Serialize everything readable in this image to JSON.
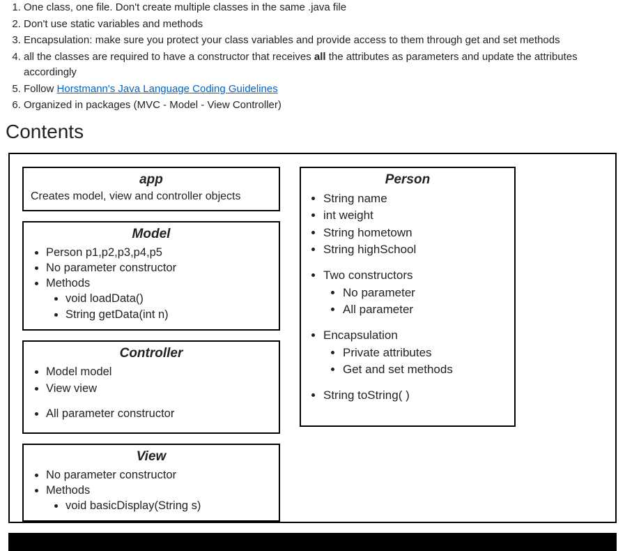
{
  "rules": {
    "r1": "One class, one file. Don't create multiple classes in the same .java file",
    "r2": "Don't use static variables and methods",
    "r3": "Encapsulation: make sure you protect your class variables and provide access to them through get and set methods",
    "r4a": "all the classes are required to have a constructor that receives ",
    "r4b": "all",
    "r4c": " the attributes as parameters and update the attributes accordingly",
    "r5a": "Follow ",
    "r5link": "Horstmann's Java Language Coding Guidelines",
    "r6": "Organized in packages (MVC - Model - View Controller)"
  },
  "contents_heading": "Contents",
  "app": {
    "title": "app",
    "desc": "Creates model, view and controller objects"
  },
  "model": {
    "title": "Model",
    "i1": "Person p1,p2,p3,p4,p5",
    "i2": "No parameter constructor",
    "i3": "Methods",
    "i3a": "void loadData()",
    "i3b": "String getData(int n)"
  },
  "controller": {
    "title": "Controller",
    "i1": "Model model",
    "i2": "View view",
    "i3": "All parameter constructor"
  },
  "view": {
    "title": "View",
    "i1": "No parameter constructor",
    "i2": "Methods",
    "i2a": "void basicDisplay(String s)"
  },
  "person": {
    "title": "Person",
    "a1": "String name",
    "a2": "int weight",
    "a3": "String hometown",
    "a4": "String highSchool",
    "c1": "Two constructors",
    "c1a": "No parameter",
    "c1b": "All parameter",
    "e1": "Encapsulation",
    "e1a": "Private attributes",
    "e1b": "Get and set methods",
    "s1": "String toString( )"
  }
}
